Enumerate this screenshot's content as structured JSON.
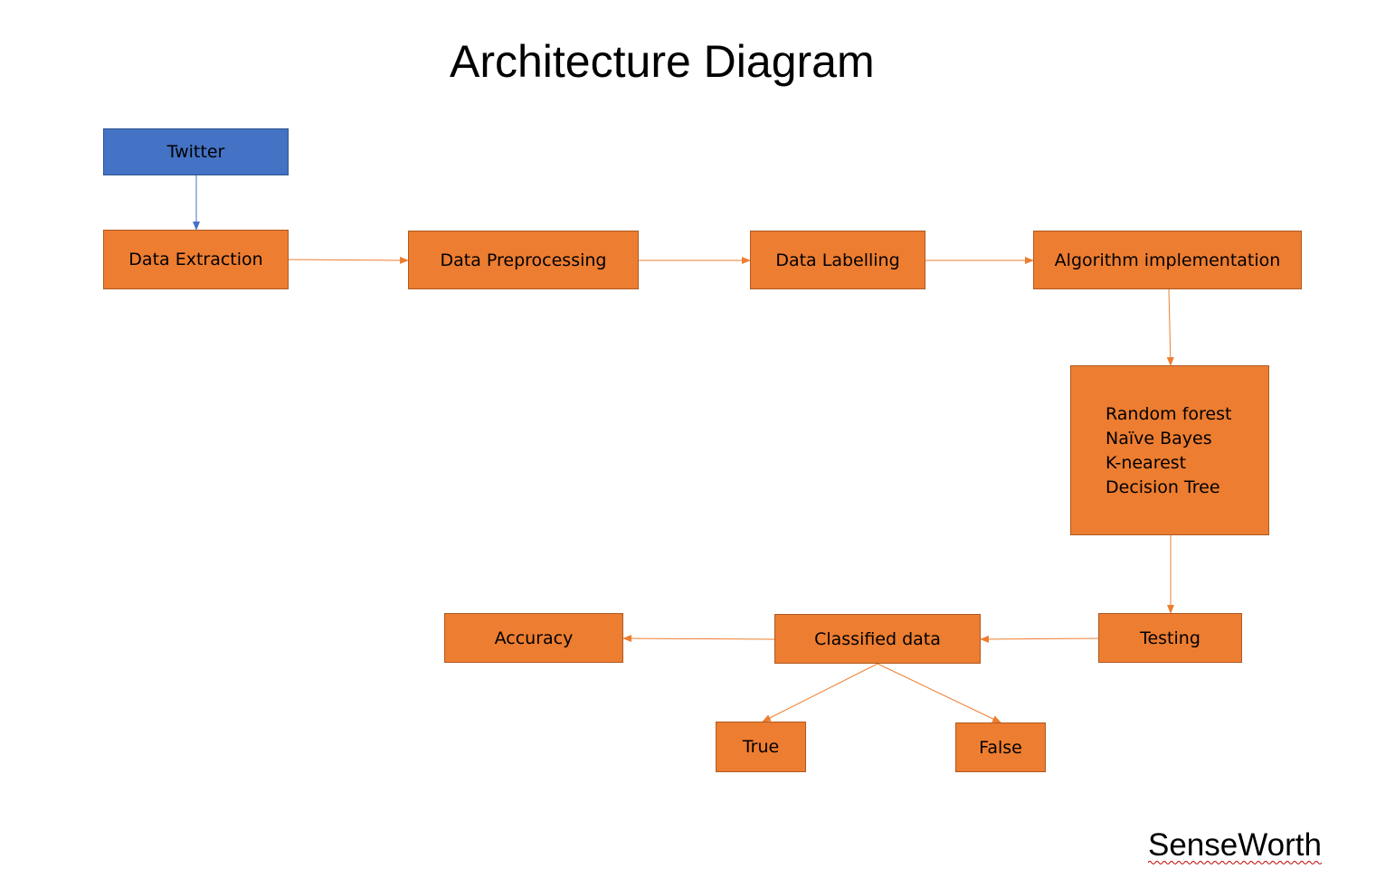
{
  "title": "Architecture Diagram",
  "brand": "SenseWorth",
  "colors": {
    "process": "#ED7D31",
    "process_border": "#AE5A21",
    "source": "#4472C4",
    "source_border": "#2F528F",
    "source_arrow": "#4472C4",
    "arrow": "#ED7D31",
    "spellcheck": "#C00000"
  },
  "nodes": {
    "twitter": "Twitter",
    "data_extraction": "Data Extraction",
    "data_preprocessing": "Data Preprocessing",
    "data_labelling": "Data Labelling",
    "algorithm_implementation": "Algorithm implementation",
    "algorithms": [
      "Random forest",
      "Naïve Bayes",
      "K-nearest",
      "Decision Tree"
    ],
    "testing": "Testing",
    "classified_data": "Classified data",
    "accuracy": "Accuracy",
    "true": "True",
    "false": "False"
  }
}
